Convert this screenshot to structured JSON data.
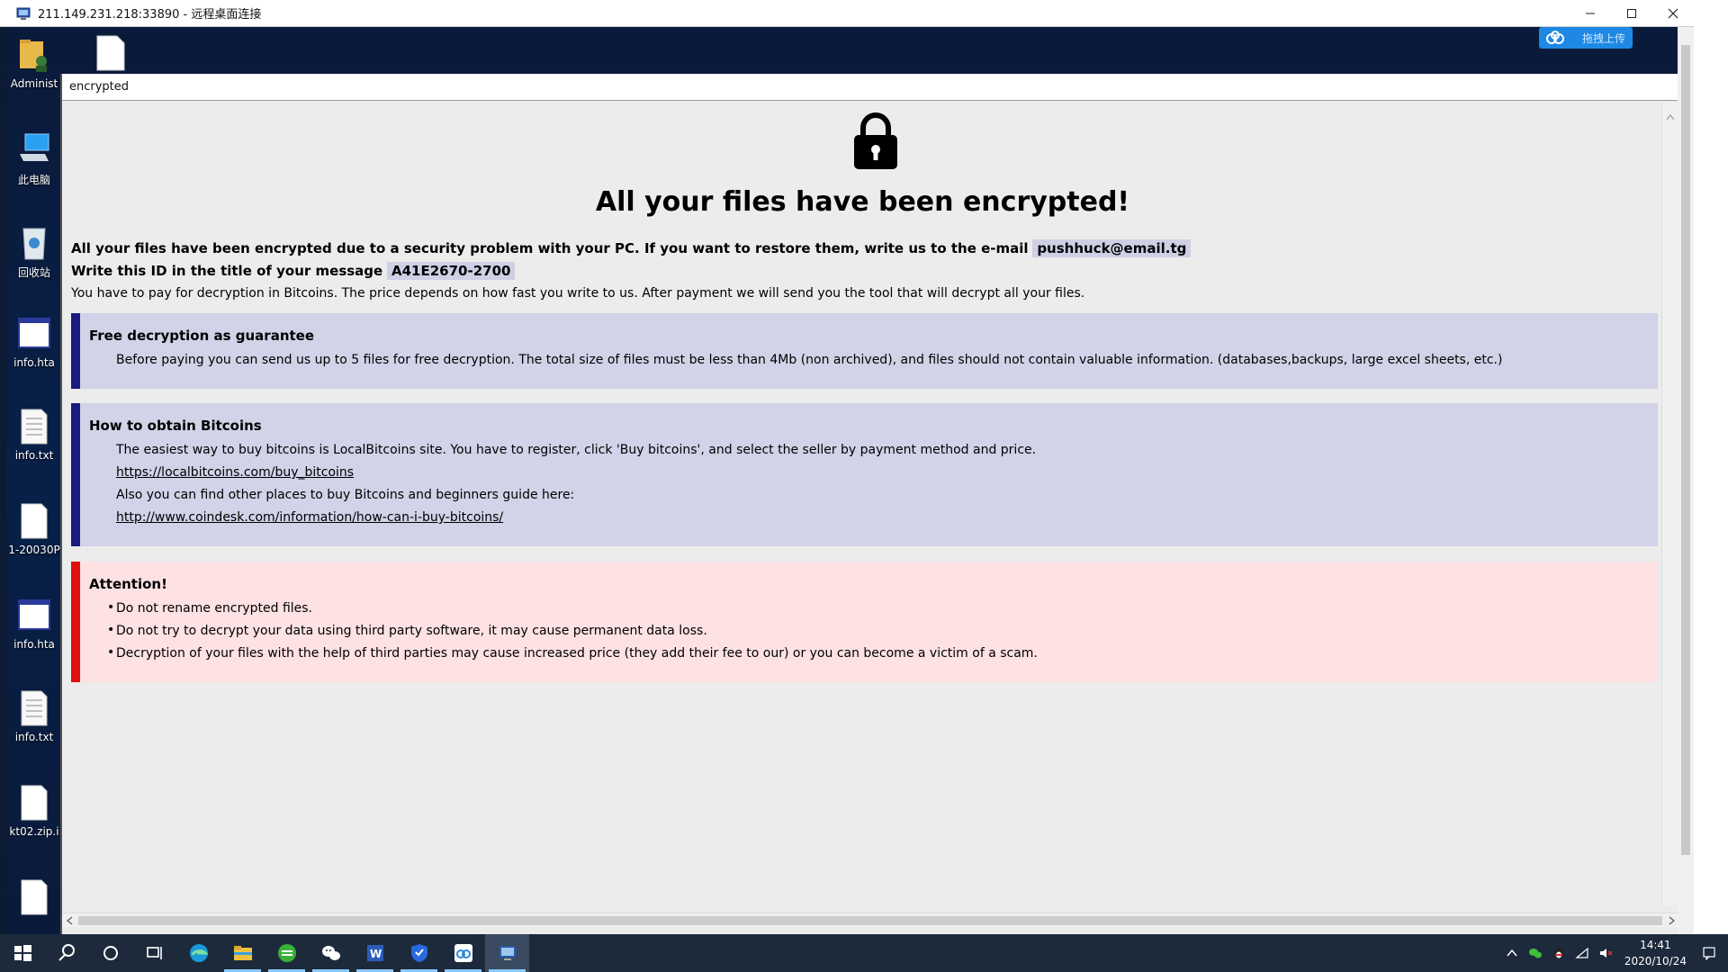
{
  "rdp_window": {
    "title": "211.149.231.218:33890 - 远程桌面连接"
  },
  "upload_badge": {
    "label": "拖拽上传",
    "accent": "#1e88e5"
  },
  "desktop_icons": [
    {
      "label": "Administ",
      "icon": "user-folder-icon"
    },
    {
      "label": "此电脑",
      "icon": "computer-icon"
    },
    {
      "label": "回收站",
      "icon": "recycle-bin-icon"
    },
    {
      "label": "info.hta",
      "icon": "hta-window-icon"
    },
    {
      "label": "info.txt",
      "icon": "text-file-icon"
    },
    {
      "label": "1-20030P",
      "icon": "blank-file-icon"
    },
    {
      "label": "info.hta",
      "icon": "hta-window-icon"
    },
    {
      "label": "info.txt",
      "icon": "text-file-icon"
    },
    {
      "label": "kt02.zip.i",
      "icon": "blank-file-icon"
    },
    {
      "label": "",
      "icon": "blank-file-icon"
    }
  ],
  "hta": {
    "title": "encrypted",
    "headline": "All your files have been encrypted!",
    "line1_text": "All your files have been encrypted due to a security problem with your PC. If you want to restore them, write us to the e-mail",
    "email": "pushhuck@email.tg",
    "line2_text": "Write this ID in the title of your message",
    "id": "A41E2670-2700",
    "line3_text": "You have to pay for decryption in Bitcoins. The price depends on how fast you write to us. After payment we will send you the tool that will decrypt all your files.",
    "panel1": {
      "title": "Free decryption as guarantee",
      "text": "Before paying you can send us up to 5 files for free decryption. The total size of files must be less than 4Mb (non archived), and files should not contain valuable information. (databases,backups, large excel sheets, etc.)"
    },
    "panel2": {
      "title": "How to obtain Bitcoins",
      "text1": "The easiest way to buy bitcoins is LocalBitcoins site. You have to register, click 'Buy bitcoins', and select the seller by payment method and price.",
      "link1": "https://localbitcoins.com/buy_bitcoins",
      "text2": "Also you can find other places to buy Bitcoins and beginners guide here:",
      "link2": "http://www.coindesk.com/information/how-can-i-buy-bitcoins/"
    },
    "panel3": {
      "title": "Attention!",
      "bullets": [
        "Do not rename encrypted files.",
        "Do not try to decrypt your data using third party software, it may cause permanent data loss.",
        "Decryption of your files with the help of third parties may cause increased price (they add their fee to our) or you can become a victim of a scam."
      ]
    },
    "colors": {
      "blue_panel": "#d2d2e8",
      "blue_border": "#1a1a80",
      "red_panel": "#fde1e3",
      "red_border": "#e01010",
      "link": "#1a4fd0"
    }
  },
  "taskbar": {
    "items": [
      "start-icon",
      "search-icon",
      "cortana-icon",
      "task-view-icon",
      "edge-icon",
      "file-explorer-icon",
      "browser-360-icon",
      "wechat-icon",
      "word-icon",
      "security-shield-icon",
      "baidu-netdisk-icon",
      "remote-desktop-icon"
    ],
    "clock_time": "14:41",
    "clock_date": "2020/10/24"
  }
}
